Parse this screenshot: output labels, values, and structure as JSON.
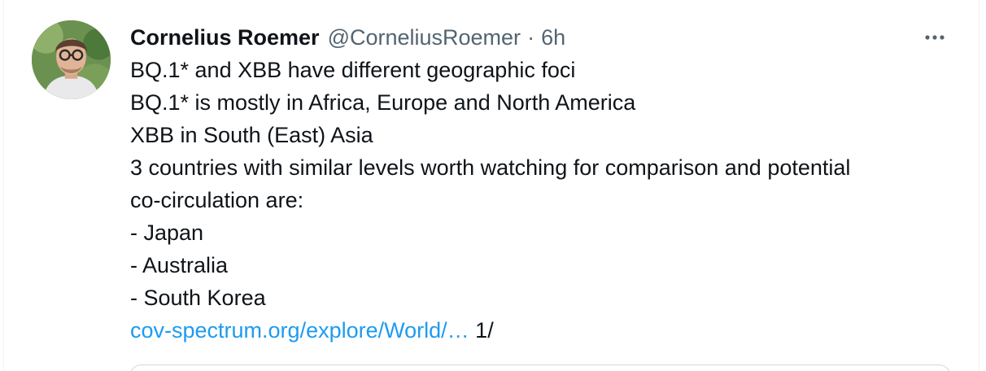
{
  "tweet": {
    "author": {
      "display_name": "Cornelius Roemer",
      "handle": "@CorneliusRoemer",
      "avatar_icon": "profile-photo"
    },
    "separator": "·",
    "time": "6h",
    "more_icon": "more-horizontal-icon",
    "lines": [
      "BQ.1* and XBB have different geographic foci",
      "BQ.1* is mostly in Africa, Europe and North America",
      "XBB in South (East) Asia",
      "3 countries with similar levels worth watching for comparison and potential",
      "co-circulation are:",
      "- Japan",
      "- Australia",
      "- South Korea"
    ],
    "link_text": "cov-spectrum.org/explore/World/…",
    "thread_marker": "1/"
  },
  "colors": {
    "text": "#0f1419",
    "secondary": "#536471",
    "link": "#1d9bf0",
    "border": "#cfd9de"
  }
}
